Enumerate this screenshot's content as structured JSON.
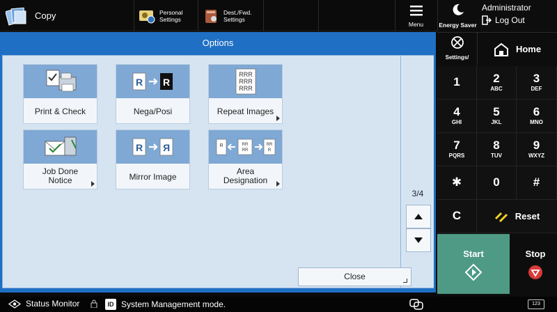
{
  "header": {
    "app_title": "Copy",
    "personal_settings_label": "Personal\nSettings",
    "dest_fwd_settings_label": "Dest./Fwd.\nSettings",
    "menu_label": "Menu"
  },
  "right_panel": {
    "energy_saver_label": "Energy Saver",
    "user_name": "Administrator",
    "logout_label": "Log Out",
    "settings_registration_label": "Settings/\nRegistration",
    "home_label": "Home",
    "keys": [
      {
        "digit": "1",
        "letters": ""
      },
      {
        "digit": "2",
        "letters": "ABC"
      },
      {
        "digit": "3",
        "letters": "DEF"
      },
      {
        "digit": "4",
        "letters": "GHI"
      },
      {
        "digit": "5",
        "letters": "JKL"
      },
      {
        "digit": "6",
        "letters": "MNO"
      },
      {
        "digit": "7",
        "letters": "PQRS"
      },
      {
        "digit": "8",
        "letters": "TUV"
      },
      {
        "digit": "9",
        "letters": "WXYZ"
      },
      {
        "digit": "✱",
        "letters": ""
      },
      {
        "digit": "0",
        "letters": ""
      },
      {
        "digit": "#",
        "letters": ""
      },
      {
        "digit": "C",
        "letters": ""
      }
    ],
    "reset_label": "Reset",
    "start_label": "Start",
    "stop_label": "Stop",
    "start_color": "#4e9a84",
    "stop_color": "#d93a3a"
  },
  "options": {
    "title": "Options",
    "items": [
      {
        "label": "Print & Check",
        "icon": "printer-check-icon",
        "has_submenu": false
      },
      {
        "label": "Nega/Posi",
        "icon": "nega-posi-icon",
        "has_submenu": false
      },
      {
        "label": "Repeat Images",
        "icon": "repeat-images-icon",
        "has_submenu": true
      },
      {
        "label": "Job Done\nNotice",
        "icon": "email-notice-icon",
        "has_submenu": true
      },
      {
        "label": "Mirror Image",
        "icon": "mirror-image-icon",
        "has_submenu": false
      },
      {
        "label": "Area\nDesignation",
        "icon": "area-designation-icon",
        "has_submenu": true
      }
    ],
    "page_indicator": "3/4",
    "close_label": "Close",
    "panel_color": "#1f6fc4"
  },
  "status_bar": {
    "status_monitor_label": "Status Monitor",
    "id_badge": "ID",
    "mode_text": "System Management mode.",
    "keyboard_label": "123"
  }
}
